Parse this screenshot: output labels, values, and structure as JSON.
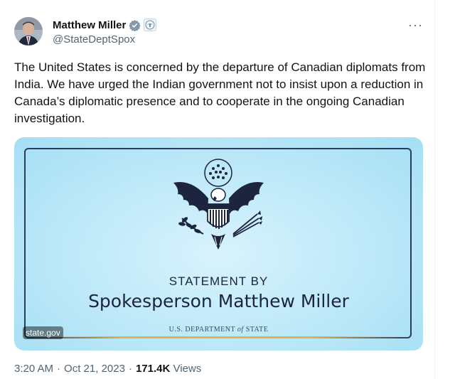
{
  "author": {
    "name": "Matthew Miller",
    "handle": "@StateDeptSpox",
    "verified_icon": "verified-badge-icon",
    "affiliation_icon": "state-department-seal-icon",
    "avatar": "profile-photo"
  },
  "menu": {
    "more_label": "···"
  },
  "tweet": {
    "text": "The United States is concerned by the departure of Canadian diplomats from India. We have urged the Indian government not to insist upon a reduction in Canada’s diplomatic presence and to cooperate in the ongoing Canadian investigation."
  },
  "card": {
    "seal_icon": "great-seal-eagle-icon",
    "statement_by": "STATEMENT BY",
    "title": "Spokesperson Matthew Miller",
    "dept_prefix": "U.S. DEPARTMENT",
    "dept_of": "of",
    "dept_suffix": "STATE",
    "domain": "state.gov"
  },
  "meta": {
    "time": "3:20 AM",
    "date": "Oct 21, 2023",
    "separator": "·",
    "views_count": "171.4K",
    "views_label": "Views"
  },
  "colors": {
    "text": "#0f1419",
    "secondary": "#536471",
    "verified": "#829aab",
    "card_navy": "#1c2440"
  }
}
